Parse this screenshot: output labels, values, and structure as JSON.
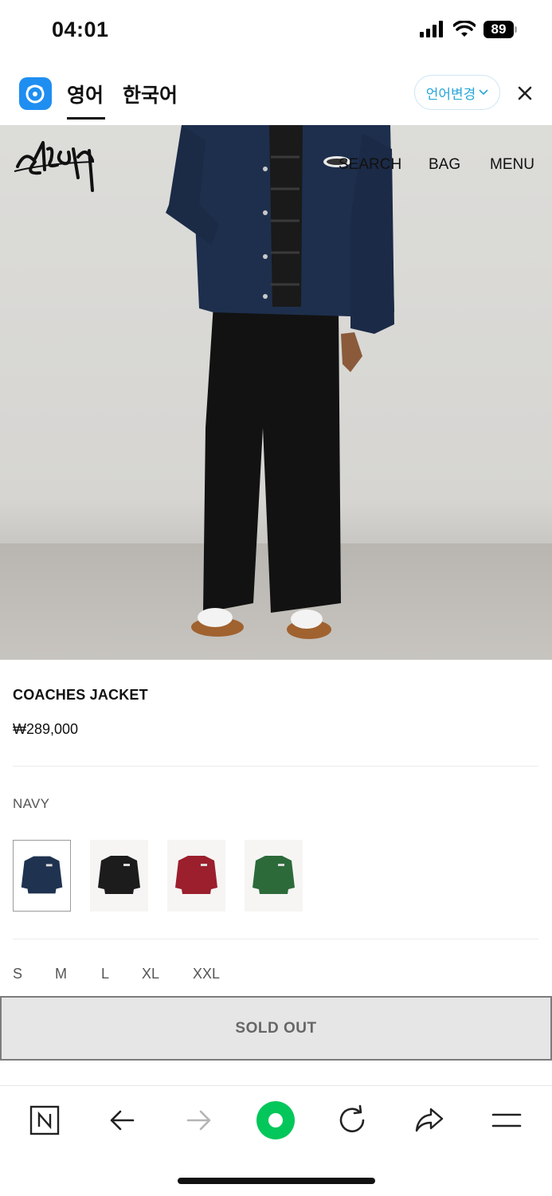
{
  "status_bar": {
    "time": "04:01",
    "battery": "89"
  },
  "translation_bar": {
    "tabs": [
      {
        "label": "영어",
        "active": true
      },
      {
        "label": "한국어",
        "active": false
      }
    ],
    "change_label": "언어변경"
  },
  "site_nav": {
    "search": "SEARCH",
    "bag": "BAG",
    "menu": "MENU"
  },
  "product": {
    "name": "COACHES JACKET",
    "price": "₩289,000",
    "selected_color": "NAVY",
    "swatches": [
      {
        "color": "#1f3350",
        "selected": true
      },
      {
        "color": "#1c1c1c",
        "selected": false
      },
      {
        "color": "#9b1f2c",
        "selected": false
      },
      {
        "color": "#2d6a3a",
        "selected": false
      }
    ],
    "sizes": [
      "S",
      "M",
      "L",
      "XL",
      "XXL"
    ],
    "sold_out_label": "SOLD OUT"
  },
  "colors": {
    "accent": "#1f8ef1",
    "naver_green": "#03c75a"
  }
}
